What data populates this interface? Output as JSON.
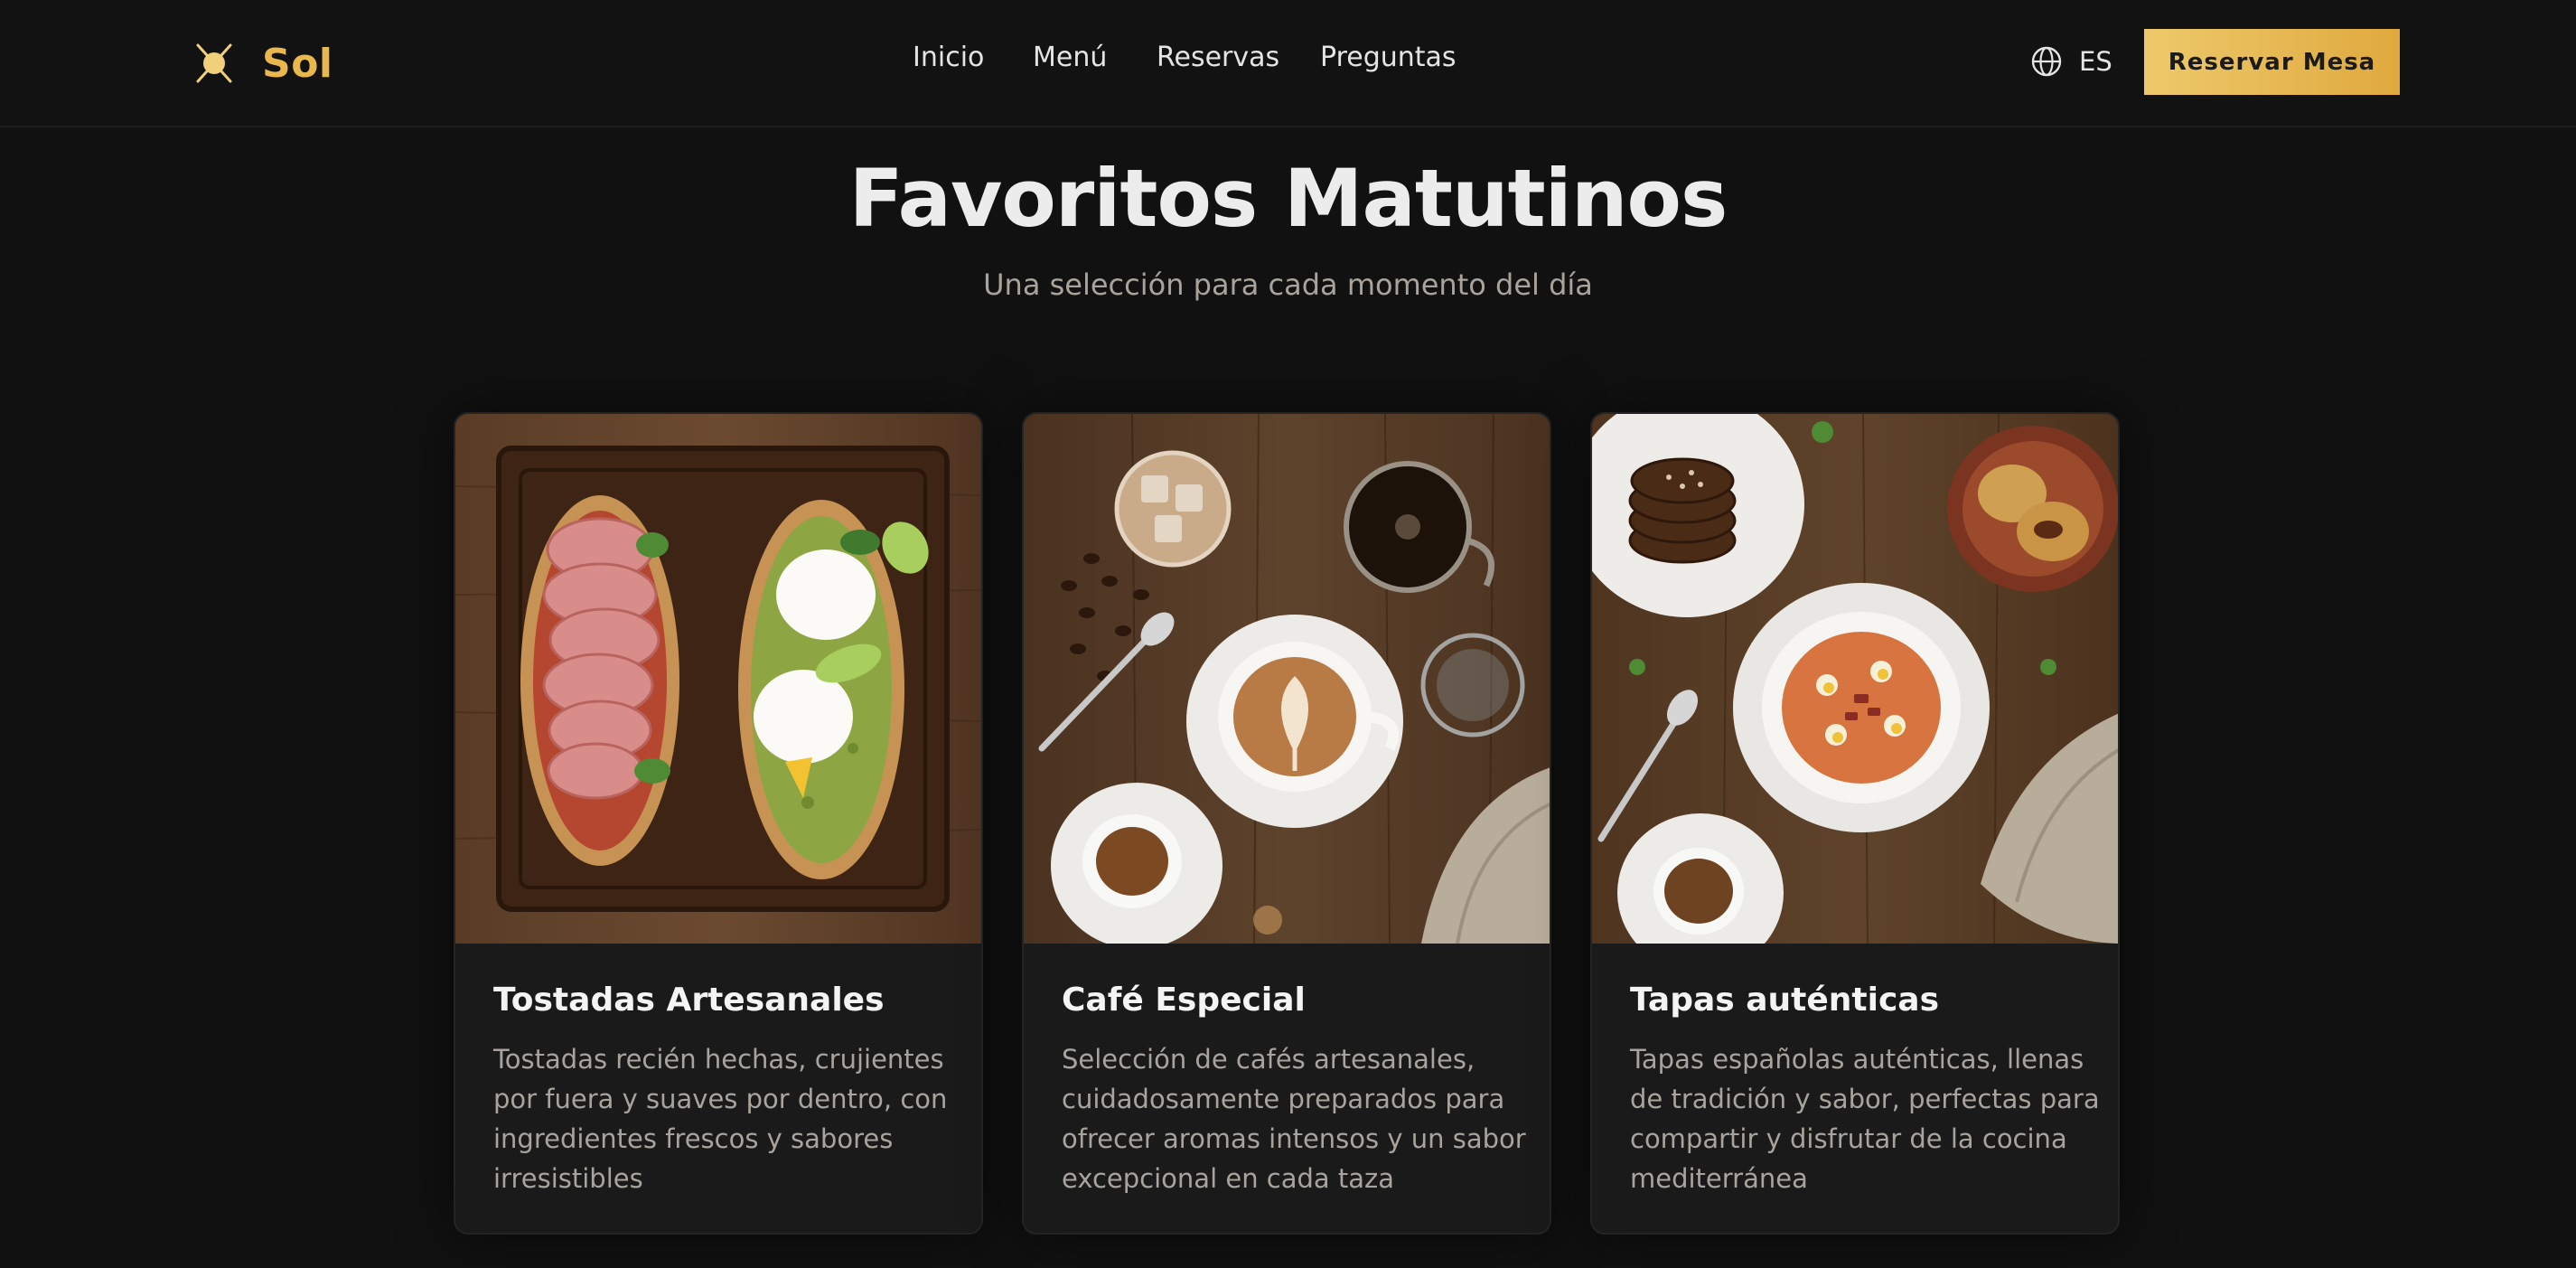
{
  "header": {
    "brand": "Sol",
    "logo_icon": "sun-logo-icon",
    "nav": [
      "Inicio",
      "Menú",
      "Reservas",
      "Preguntas"
    ],
    "language": "ES",
    "language_icon": "globe-icon",
    "cta_label": "Reservar Mesa"
  },
  "section": {
    "title": "Favoritos Matutinos",
    "subtitle": "Una selección para cada momento del día"
  },
  "cards": [
    {
      "title": "Tostadas Artesanales",
      "description": "Tostadas recién hechas, crujientes por fuera y suaves por dentro, con ingredientes frescos y sabores irresistibles",
      "image": "toast-board-image"
    },
    {
      "title": "Café Especial",
      "description": "Selección de cafés artesanales, cuidadosamente preparados para ofrecer aromas intensos y un sabor excepcional en cada taza",
      "image": "coffee-cups-image"
    },
    {
      "title": "Tapas auténticas",
      "description": "Tapas españolas auténticas, llenas de tradición y sabor, perfectas para compartir y disfrutar de la cocina mediterránea",
      "image": "tapas-spread-image"
    }
  ],
  "colors": {
    "background": "#111111",
    "accent": "#e8b84f",
    "card": "#1a1a1a",
    "text_muted": "#a8a39c"
  }
}
